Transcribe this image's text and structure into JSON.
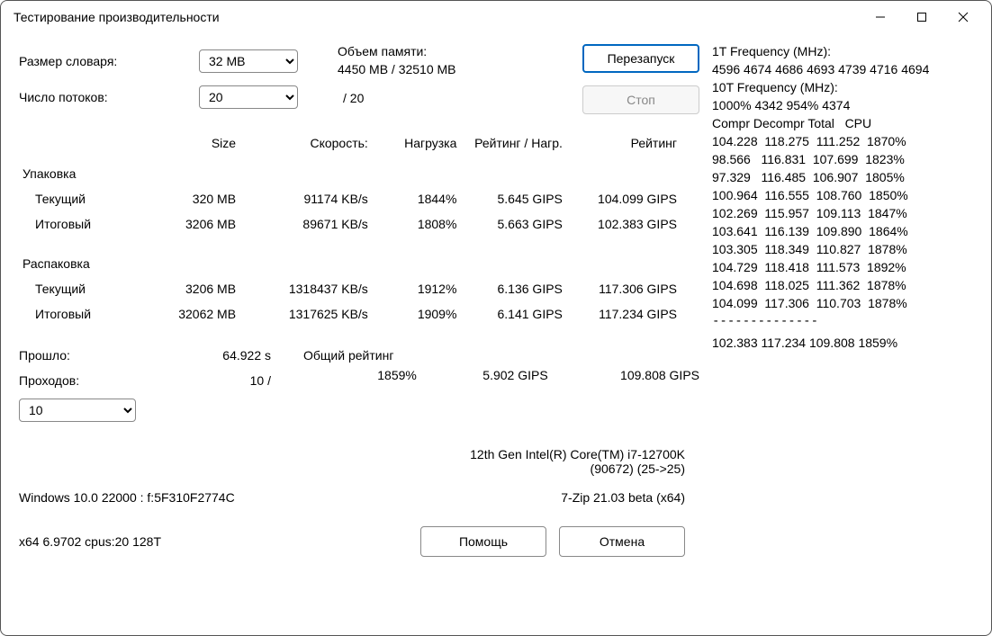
{
  "window": {
    "title": "Тестирование производительности"
  },
  "labels": {
    "dict_size": "Размер словаря:",
    "threads": "Число потоков:",
    "mem": "Объем памяти:",
    "restart": "Перезапуск",
    "stop": "Стоп",
    "elapsed": "Прошло:",
    "passes": "Проходов:",
    "overall": "Общий рейтинг",
    "help": "Помощь",
    "cancel": "Отмена"
  },
  "selects": {
    "dict_size": "32 MB",
    "threads": "20",
    "pass_limit": "10"
  },
  "mem_used": "4450 MB / 32510 MB",
  "threads_max": "/ 20",
  "headers": {
    "size": "Size",
    "speed": "Скорость:",
    "usage": "Нагрузка",
    "rating_usage": "Рейтинг / Нагр.",
    "rating": "Рейтинг"
  },
  "groups": {
    "pack": "Упаковка",
    "unpack": "Распаковка"
  },
  "rows": {
    "pack_current": {
      "name": "Текущий",
      "size": "320 MB",
      "speed": "91174 KB/s",
      "usage": "1844%",
      "ru": "5.645 GIPS",
      "rating": "104.099 GIPS"
    },
    "pack_total": {
      "name": "Итоговый",
      "size": "3206 MB",
      "speed": "89671 KB/s",
      "usage": "1808%",
      "ru": "5.663 GIPS",
      "rating": "102.383 GIPS"
    },
    "unpack_current": {
      "name": "Текущий",
      "size": "3206 MB",
      "speed": "1318437 KB/s",
      "usage": "1912%",
      "ru": "6.136 GIPS",
      "rating": "117.306 GIPS"
    },
    "unpack_total": {
      "name": "Итоговый",
      "size": "32062 MB",
      "speed": "1317625 KB/s",
      "usage": "1909%",
      "ru": "6.141 GIPS",
      "rating": "117.234 GIPS"
    }
  },
  "elapsed": "64.922 s",
  "passes_done": "10 /",
  "overall": {
    "usage": "1859%",
    "ru": "5.902 GIPS",
    "rating": "109.808 GIPS"
  },
  "cpu_info_1": "12th Gen Intel(R) Core(TM) i7-12700K",
  "cpu_info_2": "(90672) (25->25)",
  "os_info": "Windows 10.0 22000 :  f:5F310F2774C",
  "zip_info": "7-Zip 21.03 beta (x64)",
  "arch_info": "x64 6.9702 cpus:20 128T",
  "freq": {
    "head1": "1T Frequency (MHz):",
    "line1": " 4596 4674 4686 4693 4739 4716 4694",
    "head2": "10T Frequency (MHz):",
    "line2": " 1000% 4342 954% 4374",
    "tbl_head": "Compr Decompr Total   CPU",
    "rows": [
      "104.228  118.275  111.252  1870%",
      "98.566   116.831  107.699  1823%",
      "97.329   116.485  106.907  1805%",
      "100.964  116.555  108.760  1850%",
      "102.269  115.957  109.113  1847%",
      "103.641  116.139  109.890  1864%",
      "103.305  118.349  110.827  1878%",
      "104.729  118.418  111.573  1892%",
      "104.698  118.025  111.362  1878%",
      "104.099  117.306  110.703  1878%"
    ],
    "sep": "--------------",
    "final": "102.383  117.234  109.808  1859%"
  }
}
